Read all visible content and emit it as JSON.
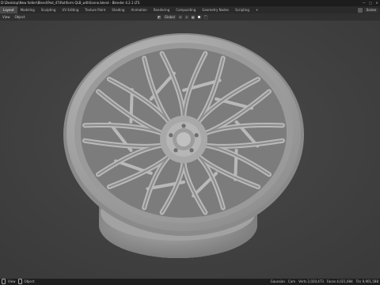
{
  "window": {
    "title": "D:\\Desktop\\New folder\\Blend\\Pod_47\\Rotiform QLB_withScene.blend - Blender 4.2.1 LTS",
    "controls": [
      "—",
      "▢",
      "✕"
    ]
  },
  "tabs": [
    "Layout",
    "Modeling",
    "Sculpting",
    "UV Editing",
    "Texture Paint",
    "Shading",
    "Animation",
    "Rendering",
    "Compositing",
    "Geometry Nodes",
    "Scripting",
    "+"
  ],
  "active_tab": "Layout",
  "scene": {
    "label": "Scene"
  },
  "header": {
    "view_label": "View",
    "object_label": "Object",
    "transform_orientation": "Global"
  },
  "status": {
    "left_hint": "View",
    "object_hint": "Object",
    "right_items": [
      "Gaussian",
      "Cam",
      "Verts 2,020,473",
      "Faces 4,021,984",
      "Tris 9,901,588"
    ]
  },
  "colors": {
    "accent": "#4a7ac9",
    "viewport_bg": "#3f3f3f",
    "wheel": "#a6a6a6"
  },
  "icons": {
    "mode": "object-mode-icon",
    "snap": "magnet-icon",
    "proportional": "circle-dot-icon"
  }
}
